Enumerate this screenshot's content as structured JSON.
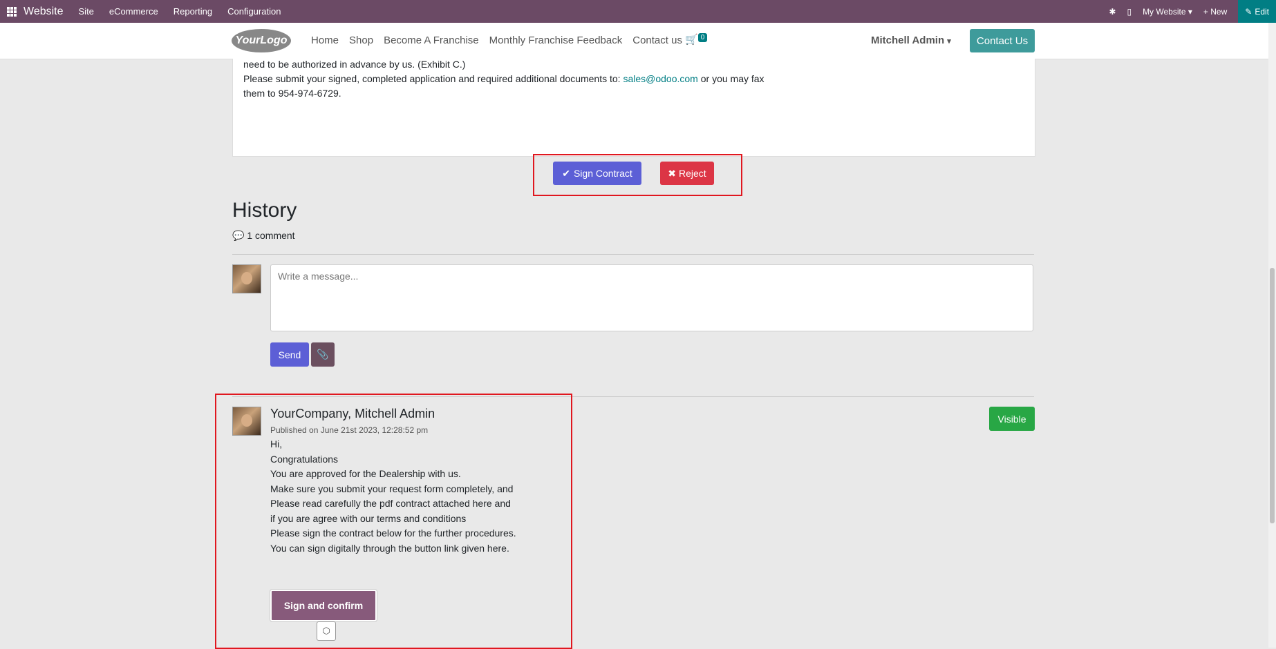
{
  "topbar": {
    "app_name": "Website",
    "menu": [
      "Site",
      "eCommerce",
      "Reporting",
      "Configuration"
    ],
    "website": "My Website",
    "new_label": "+ New",
    "edit_label": "Edit"
  },
  "header": {
    "logo": "YourLogo",
    "nav": [
      "Home",
      "Shop",
      "Become A Franchise",
      "Monthly Franchise Feedback",
      "Contact us"
    ],
    "cart_count": "0",
    "user": "Mitchell Admin",
    "contact_button": "Contact Us"
  },
  "contract": {
    "line1": "need to be authorized in advance by us. (Exhibit C.)",
    "line2_pre": "Please submit your signed, completed application and required additional documents to: ",
    "email": "sales@odoo.com",
    "line2_post": " or you may fax",
    "line3": "them to 954-974-6729.",
    "sign_button": "Sign Contract",
    "reject_button": "Reject"
  },
  "history": {
    "title": "History",
    "comment_count": "1 comment",
    "placeholder": "Write a message...",
    "send_button": "Send"
  },
  "message": {
    "author": "YourCompany, Mitchell Admin",
    "date": "Published on June 21st 2023, 12:28:52 pm",
    "lines": [
      "Hi,",
      "Congratulations",
      "You are approved for the Dealership with us.",
      "Make sure you submit your request form completely, and",
      "Please read carefully the pdf contract attached here and",
      "if you are agree with our terms and conditions",
      "Please sign the contract below for the further procedures.",
      "You can sign digitally through the button link given here."
    ],
    "visibility": "Visible",
    "sign_confirm_button": "Sign and confirm"
  },
  "colors": {
    "topbar": "#6b4a65",
    "primary_button": "#5c5fd6",
    "reject_button": "#dc3545",
    "highlight_box": "#e0171f",
    "visible_badge": "#28a745",
    "sign_confirm": "#875a7b"
  }
}
